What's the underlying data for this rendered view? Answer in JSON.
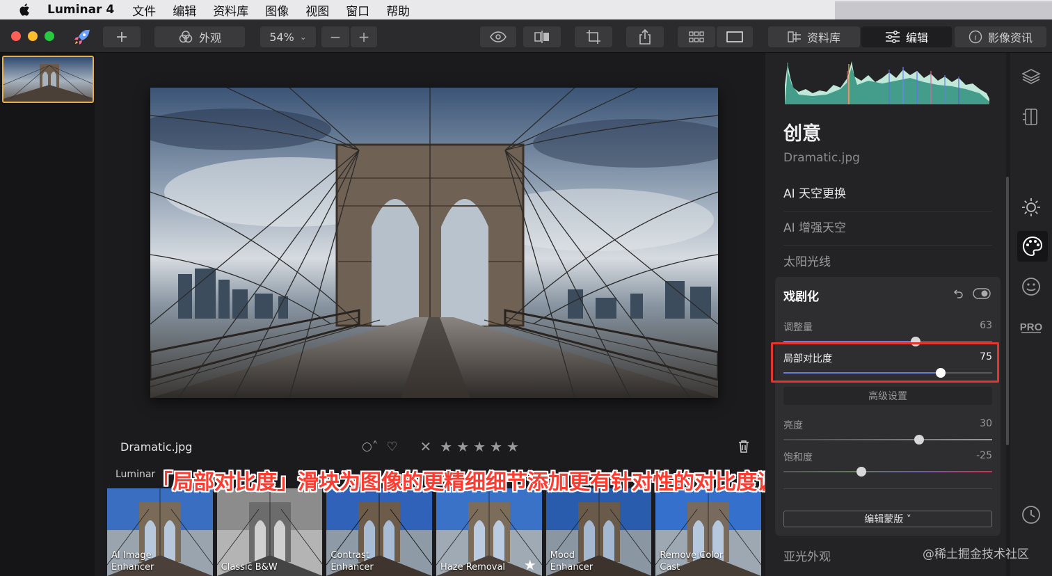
{
  "menubar": {
    "app_name": "Luminar 4",
    "items": [
      "文件",
      "编辑",
      "资料库",
      "图像",
      "视图",
      "窗口",
      "帮助"
    ]
  },
  "toolbar": {
    "look_label": "外观",
    "zoom": "54%",
    "library_tab": "资料库",
    "edit_tab": "编辑",
    "info_tab": "影像资讯"
  },
  "center": {
    "filename": "Dramatic.jpg",
    "presets_label": "Luminar",
    "presets": [
      {
        "label": "AI Image\nEnhancer"
      },
      {
        "label": "Classic B&W"
      },
      {
        "label": "Contrast\nEnhancer"
      },
      {
        "label": "Haze Removal"
      },
      {
        "label": "Mood\nEnhancer"
      },
      {
        "label": "Remove Color\nCast"
      }
    ],
    "caption": "「局部对比度」滑块为图像的更精细细节添加更有针对性的对比度调整"
  },
  "panel": {
    "title": "创意",
    "file": "Dramatic.jpg",
    "items": [
      "AI 天空更换",
      "AI 增强天空",
      "太阳光线"
    ],
    "card": {
      "title": "戏剧化",
      "sliders": [
        {
          "label": "调整量",
          "value": "63",
          "pos": 0.63
        },
        {
          "label": "局部对比度",
          "value": "75",
          "pos": 0.75
        },
        {
          "label": "亮度",
          "value": "30",
          "pos": 0.65
        },
        {
          "label": "饱和度",
          "value": "-25",
          "pos": 0.375
        }
      ],
      "advanced": "高级设置",
      "mask": "编辑蒙版 ˅"
    },
    "bottom_item": "亚光外观"
  },
  "watermark": "@稀土掘金技术社区",
  "colors": {
    "accent": "#6c7dd6",
    "highlight": "#e5362b",
    "selection": "#e8b04a"
  }
}
